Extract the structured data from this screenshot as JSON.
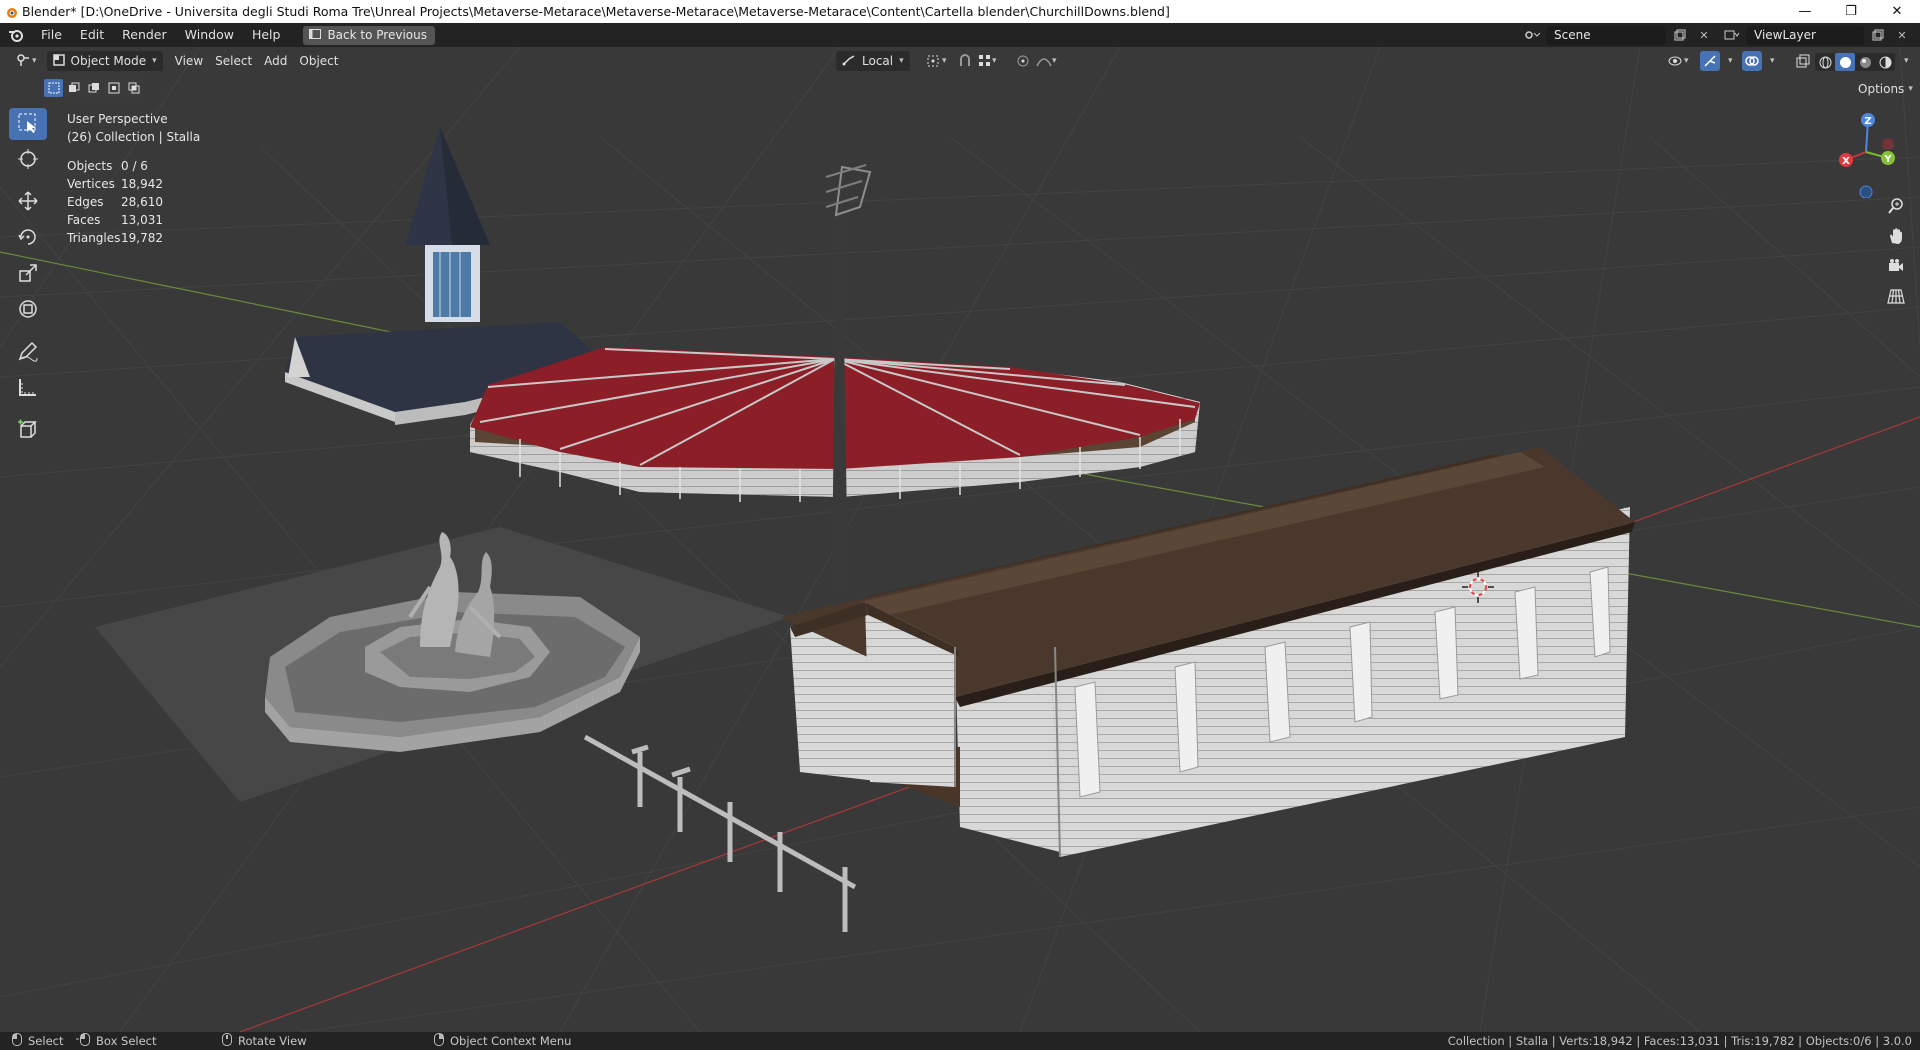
{
  "titlebar": {
    "title": "Blender* [D:\\OneDrive - Universita degli Studi Roma Tre\\Unreal Projects\\Metaverse-Metarace\\Metaverse-Metarace\\Metaverse-Metarace\\Content\\Cartella blender\\ChurchillDowns.blend]",
    "minimize": "—",
    "restore": "❐",
    "close": "✕"
  },
  "menubar": {
    "items": [
      "File",
      "Edit",
      "Render",
      "Window",
      "Help"
    ],
    "back_button": "Back to Previous",
    "scene": "Scene",
    "view_layer": "ViewLayer"
  },
  "viewport_header": {
    "mode": "Object Mode",
    "menus": [
      "View",
      "Select",
      "Add",
      "Object"
    ],
    "transform_orientation": "Local",
    "options": "Options"
  },
  "overlay": {
    "perspective": "User Perspective",
    "collection": "(26) Collection | Stalla",
    "stats": [
      {
        "label": "Objects",
        "value": "0 / 6"
      },
      {
        "label": "Vertices",
        "value": "18,942"
      },
      {
        "label": "Edges",
        "value": "28,610"
      },
      {
        "label": "Faces",
        "value": "13,031"
      },
      {
        "label": "Triangles",
        "value": "19,782"
      }
    ]
  },
  "gizmo": {
    "x": "X",
    "y": "Y",
    "z": "Z"
  },
  "statusbar": {
    "select": "Select",
    "box_select": "Box Select",
    "rotate_view": "Rotate View",
    "context_menu": "Object Context Menu",
    "info": "Collection | Stalla | Verts:18,942 | Faces:13,031 | Tris:19,782 | Objects:0/6 | 3.0.0"
  },
  "colors": {
    "viewport_bg": "#393939",
    "accent": "#4772b3",
    "x_axis": "#b53a3a",
    "y_axis": "#7fa034",
    "roof_red": "#8b1e26"
  }
}
